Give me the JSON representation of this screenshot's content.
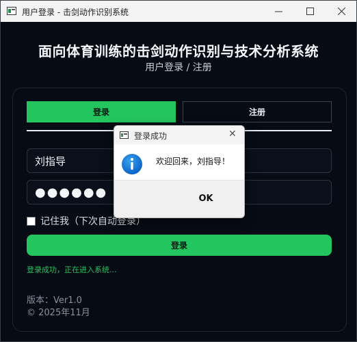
{
  "window": {
    "title": "用户登录 - 击剑动作识别系统"
  },
  "header": {
    "title": "面向体育训练的击剑动作识别与技术分析系统",
    "subtitle": "用户登录 / 注册"
  },
  "tabs": [
    {
      "label": "登录",
      "active": true
    },
    {
      "label": "注册",
      "active": false
    }
  ],
  "form": {
    "username_value": "刘指导",
    "password_mask": "●●●●●●",
    "remember_label": "记住我（下次自动登录）",
    "remember_checked": false,
    "submit_label": "登录",
    "status_text": "登录成功，正在进入系统..."
  },
  "footer": {
    "version": "版本：Ver1.0",
    "copyright": "© 2025年11月"
  },
  "dialog": {
    "title": "登录成功",
    "message": "欢迎回来，刘指导！",
    "ok_label": "OK",
    "icon": "info-icon"
  },
  "colors": {
    "accent": "#22c55e",
    "background": "#070b14"
  }
}
